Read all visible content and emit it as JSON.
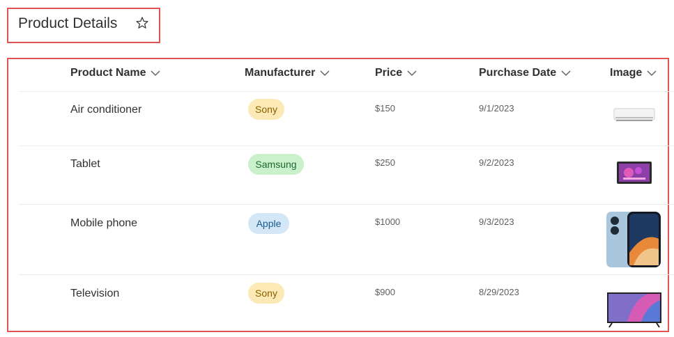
{
  "page": {
    "title": "Product Details",
    "star_icon": "star-outline-icon"
  },
  "table": {
    "columns": [
      {
        "label": "Product Name",
        "icon": "chevron-down-icon"
      },
      {
        "label": "Manufacturer",
        "icon": "chevron-down-icon"
      },
      {
        "label": "Price",
        "icon": "chevron-down-icon"
      },
      {
        "label": "Purchase Date",
        "icon": "chevron-down-icon"
      },
      {
        "label": "Image",
        "icon": "chevron-down-icon"
      }
    ],
    "rows": [
      {
        "name": "Air conditioner",
        "manufacturer": "Sony",
        "manufacturer_color": "#fce9b5",
        "manufacturer_text_color": "#8a6100",
        "price": "$150",
        "date": "9/1/2023",
        "image": "air-conditioner-image"
      },
      {
        "name": "Tablet",
        "manufacturer": "Samsung",
        "manufacturer_color": "#caf0cc",
        "manufacturer_text_color": "#1c6b2d",
        "price": "$250",
        "date": "9/2/2023",
        "image": "tablet-image"
      },
      {
        "name": "Mobile phone",
        "manufacturer": "Apple",
        "manufacturer_color": "#d4e7f6",
        "manufacturer_text_color": "#1b5a91",
        "price": "$1000",
        "date": "9/3/2023",
        "image": "mobile-phone-image"
      },
      {
        "name": "Television",
        "manufacturer": "Sony",
        "manufacturer_color": "#fce9b5",
        "manufacturer_text_color": "#8a6100",
        "price": "$900",
        "date": "8/29/2023",
        "image": "television-image"
      }
    ]
  },
  "colors": {
    "highlight_border": "#e05353",
    "divider": "#edebe9"
  }
}
